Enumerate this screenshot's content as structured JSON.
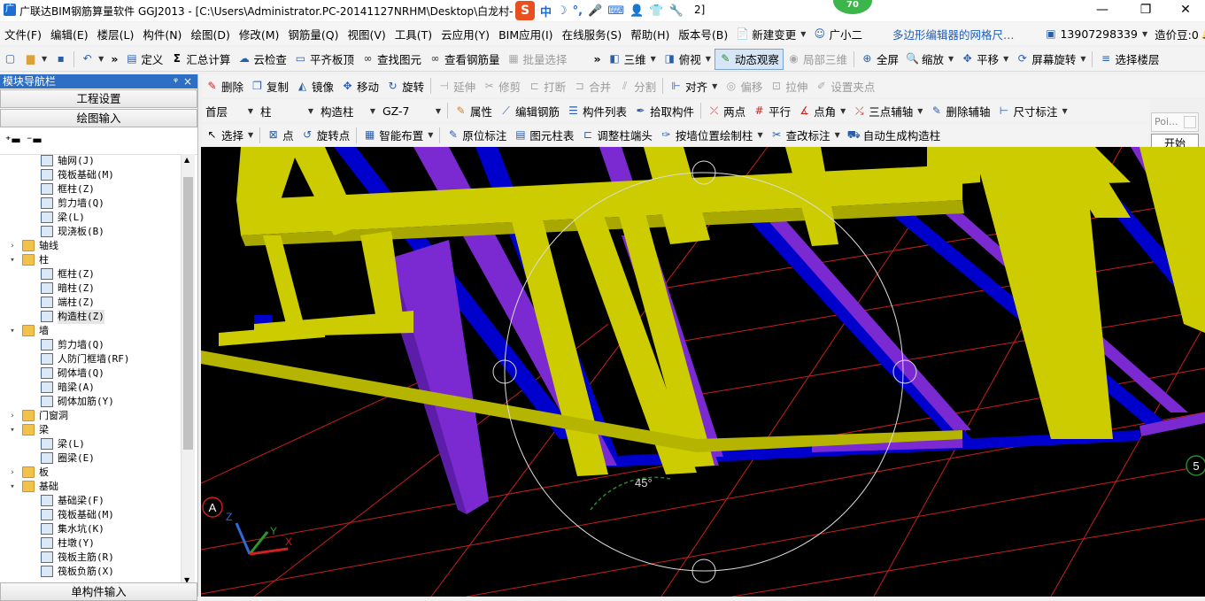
{
  "window": {
    "title": "广联达BIM钢筋算量软件 GGJ2013 - [C:\\Users\\Administrator.PC-20141127NRHM\\Desktop\\白龙村-",
    "title_tail": "2]",
    "notification_badge": "70",
    "controls": {
      "minimize": "—",
      "maximize": "❐",
      "close": "✕"
    }
  },
  "ime": {
    "logo": "S",
    "mode": "中"
  },
  "menu": {
    "items": [
      "文件(F)",
      "编辑(E)",
      "楼层(L)",
      "构件(N)",
      "绘图(D)",
      "修改(M)",
      "钢筋量(Q)",
      "视图(V)",
      "工具(T)",
      "云应用(Y)",
      "BIM应用(I)",
      "在线服务(S)",
      "帮助(H)",
      "版本号(B)"
    ],
    "new_change": "新建变更",
    "assistant": "广小二",
    "notice": "多边形编辑器的网格尺…",
    "phone": "13907298339",
    "bean": "造价豆:0"
  },
  "toolbar1": {
    "define": "定义",
    "summary": "汇总计算",
    "cloud_check": "云检查",
    "level_slab": "平齐板顶",
    "find_element": "查找图元",
    "view_rebar": "查看钢筋量",
    "batch_select": "批量选择",
    "three_d": "三维",
    "top_view": "俯视",
    "dynamic_view": "动态观察",
    "local_3d": "局部三维",
    "fullscreen": "全屏",
    "zoom": "缩放",
    "pan": "平移",
    "screen_rotate": "屏幕旋转",
    "select_floor": "选择楼层"
  },
  "toolbar2": {
    "delete": "删除",
    "copy": "复制",
    "mirror": "镜像",
    "move": "移动",
    "rotate": "旋转",
    "extend": "延伸",
    "trim": "修剪",
    "break": "打断",
    "merge": "合并",
    "split": "分割",
    "align": "对齐",
    "offset": "偏移",
    "stretch": "拉伸",
    "set_grip": "设置夹点"
  },
  "toolbar3": {
    "floor": "首层",
    "category": "柱",
    "subtype": "构造柱",
    "element": "GZ-7",
    "properties": "属性",
    "edit_rebar": "编辑钢筋",
    "element_list": "构件列表",
    "pick_element": "拾取构件",
    "two_points": "两点",
    "parallel": "平行",
    "point_angle": "点角",
    "three_point_axis": "三点辅轴",
    "delete_axis": "删除辅轴",
    "dimension": "尺寸标注"
  },
  "toolbar4": {
    "select": "选择",
    "point": "点",
    "rotate_point": "旋转点",
    "smart_layout": "智能布置",
    "original_mark": "原位标注",
    "column_table": "图元柱表",
    "adjust_column_end": "调整柱端头",
    "draw_by_wall": "按墙位置绘制柱",
    "change_mark": "查改标注",
    "auto_generate": "自动生成构造柱"
  },
  "sidebar": {
    "header": "模块导航栏",
    "pin": "ᵠ",
    "close": "×",
    "project_settings": "工程设置",
    "drawing_input": "绘图输入",
    "single_element_input": "单构件输入",
    "tree": [
      {
        "level": 2,
        "type": "leaf",
        "label": "轴网(J)"
      },
      {
        "level": 2,
        "type": "leaf",
        "label": "筏板基础(M)"
      },
      {
        "level": 2,
        "type": "leaf",
        "label": "框柱(Z)"
      },
      {
        "level": 2,
        "type": "leaf",
        "label": "剪力墙(Q)"
      },
      {
        "level": 2,
        "type": "leaf",
        "label": "梁(L)"
      },
      {
        "level": 2,
        "type": "leaf",
        "label": "现浇板(B)"
      },
      {
        "level": 1,
        "type": "folder",
        "expanded": false,
        "label": "轴线"
      },
      {
        "level": 1,
        "type": "folder",
        "expanded": true,
        "label": "柱"
      },
      {
        "level": 2,
        "type": "leaf",
        "label": "框柱(Z)"
      },
      {
        "level": 2,
        "type": "leaf",
        "label": "暗柱(Z)"
      },
      {
        "level": 2,
        "type": "leaf",
        "label": "端柱(Z)"
      },
      {
        "level": 2,
        "type": "leaf",
        "label": "构造柱(Z)",
        "selected": true
      },
      {
        "level": 1,
        "type": "folder",
        "expanded": true,
        "label": "墙"
      },
      {
        "level": 2,
        "type": "leaf",
        "label": "剪力墙(Q)"
      },
      {
        "level": 2,
        "type": "leaf",
        "label": "人防门框墙(RF)"
      },
      {
        "level": 2,
        "type": "leaf",
        "label": "砌体墙(Q)"
      },
      {
        "level": 2,
        "type": "leaf",
        "label": "暗梁(A)"
      },
      {
        "level": 2,
        "type": "leaf",
        "label": "砌体加筋(Y)"
      },
      {
        "level": 1,
        "type": "folder",
        "expanded": false,
        "label": "门窗洞"
      },
      {
        "level": 1,
        "type": "folder",
        "expanded": true,
        "label": "梁"
      },
      {
        "level": 2,
        "type": "leaf",
        "label": "梁(L)"
      },
      {
        "level": 2,
        "type": "leaf",
        "label": "圈梁(E)"
      },
      {
        "level": 1,
        "type": "folder",
        "expanded": false,
        "label": "板"
      },
      {
        "level": 1,
        "type": "folder",
        "expanded": true,
        "label": "基础"
      },
      {
        "level": 2,
        "type": "leaf",
        "label": "基础梁(F)"
      },
      {
        "level": 2,
        "type": "leaf",
        "label": "筏板基础(M)"
      },
      {
        "level": 2,
        "type": "leaf",
        "label": "集水坑(K)"
      },
      {
        "level": 2,
        "type": "leaf",
        "label": "柱墩(Y)"
      },
      {
        "level": 2,
        "type": "leaf",
        "label": "筏板主筋(R)"
      },
      {
        "level": 2,
        "type": "leaf",
        "label": "筏板负筋(X)"
      }
    ]
  },
  "viewport": {
    "rotation_angle": "45°",
    "axis_marker_a": "A",
    "axis_marker_5": "5",
    "axes": {
      "x": "X",
      "y": "Y",
      "z": "Z"
    },
    "colors": {
      "background": "#000000",
      "beams": "#cccc00",
      "walls": "#0000cc",
      "slabs": "#7a2ad0",
      "grid": "#c81e1e"
    }
  },
  "popup": {
    "title": "Poi...",
    "start": "开始"
  }
}
